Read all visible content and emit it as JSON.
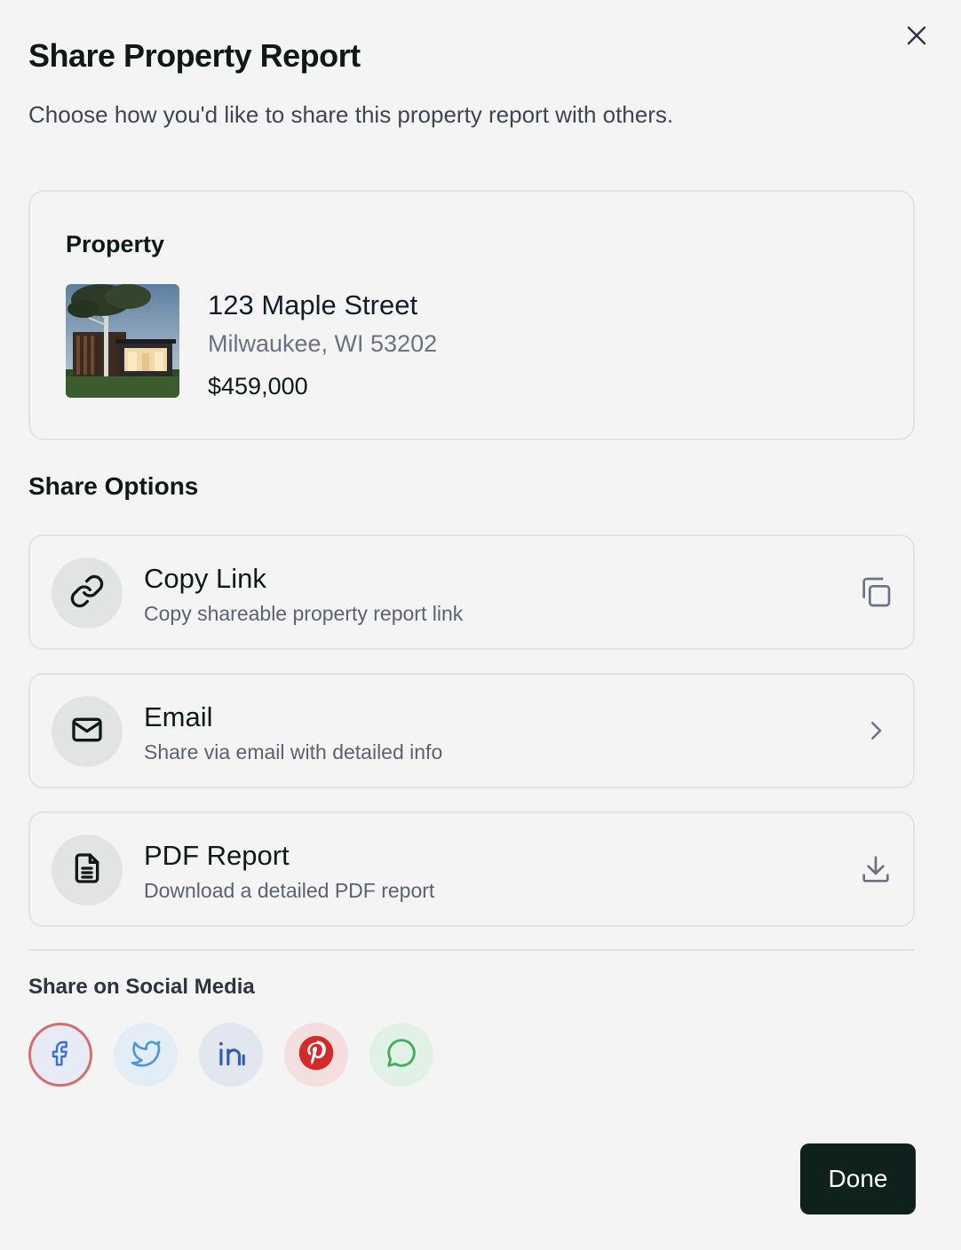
{
  "dialog": {
    "title": "Share Property Report",
    "subtitle": "Choose how you'd like to share this property report with others.",
    "close_icon": "close-icon"
  },
  "property": {
    "label": "Property",
    "address": "123 Maple Street",
    "city": "Milwaukee, WI 53202",
    "price": "$459,000"
  },
  "share_options": {
    "title": "Share Options",
    "items": [
      {
        "title": "Copy Link",
        "description": "Copy shareable property report link",
        "icon": "link-icon",
        "action_icon": "copy-icon"
      },
      {
        "title": "Email",
        "description": "Share via email with detailed info",
        "icon": "mail-icon",
        "action_icon": "chevron-right-icon"
      },
      {
        "title": "PDF Report",
        "description": "Download a detailed PDF report",
        "icon": "document-icon",
        "action_icon": "download-icon"
      }
    ]
  },
  "social": {
    "title": "Share on Social Media",
    "networks": [
      {
        "name": "facebook",
        "icon": "facebook-icon",
        "color": "#3b6fd6"
      },
      {
        "name": "twitter",
        "icon": "twitter-icon",
        "color": "#4a9ad8"
      },
      {
        "name": "linkedin",
        "icon": "linkedin-icon",
        "color": "#2f5fb0"
      },
      {
        "name": "pinterest",
        "icon": "pinterest-icon",
        "color": "#d32b2b"
      },
      {
        "name": "whatsapp",
        "icon": "chat-bubble-icon",
        "color": "#3fae5a"
      }
    ]
  },
  "footer": {
    "done_label": "Done",
    "done_color": "#0f211c"
  }
}
